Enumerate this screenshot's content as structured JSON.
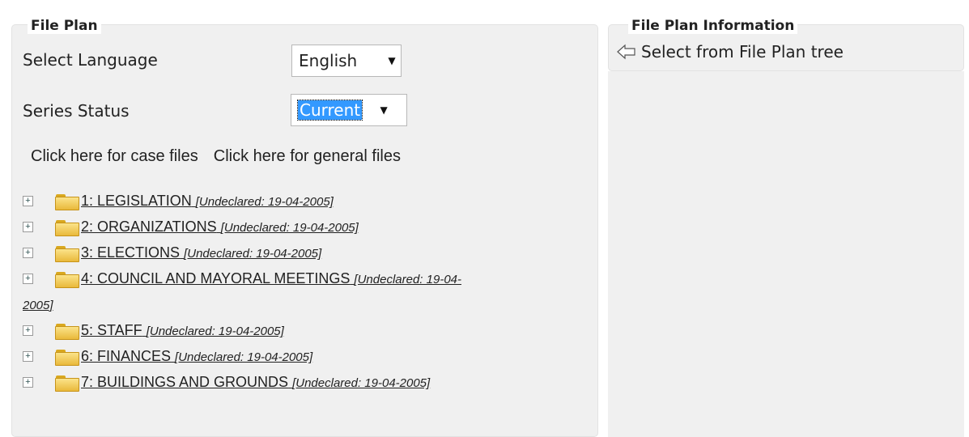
{
  "file_plan": {
    "title": "File Plan",
    "language": {
      "label": "Select Language",
      "value": "English"
    },
    "series_status": {
      "label": "Series Status",
      "value": "Current"
    },
    "links": {
      "case_files": "Click here for case files",
      "general_files": "Click here for general files"
    },
    "tree": [
      {
        "title": "1: LEGISLATION",
        "meta": "[Undeclared: 19-04-2005]"
      },
      {
        "title": "2: ORGANIZATIONS",
        "meta": "[Undeclared: 19-04-2005]"
      },
      {
        "title": "3: ELECTIONS",
        "meta": "[Undeclared: 19-04-2005]"
      },
      {
        "title": "4: COUNCIL AND MAYORAL MEETINGS",
        "meta": "[Undeclared: 19-04-",
        "meta_cont": "2005]"
      },
      {
        "title": "5: STAFF",
        "meta": "[Undeclared: 19-04-2005]"
      },
      {
        "title": "6: FINANCES",
        "meta": "[Undeclared: 19-04-2005]"
      },
      {
        "title": "7: BUILDINGS AND GROUNDS",
        "meta": "[Undeclared: 19-04-2005]"
      }
    ]
  },
  "info_panel": {
    "title": "File Plan Information",
    "hint": "Select from File Plan tree",
    "hint_icon": "arrow-left-icon"
  }
}
